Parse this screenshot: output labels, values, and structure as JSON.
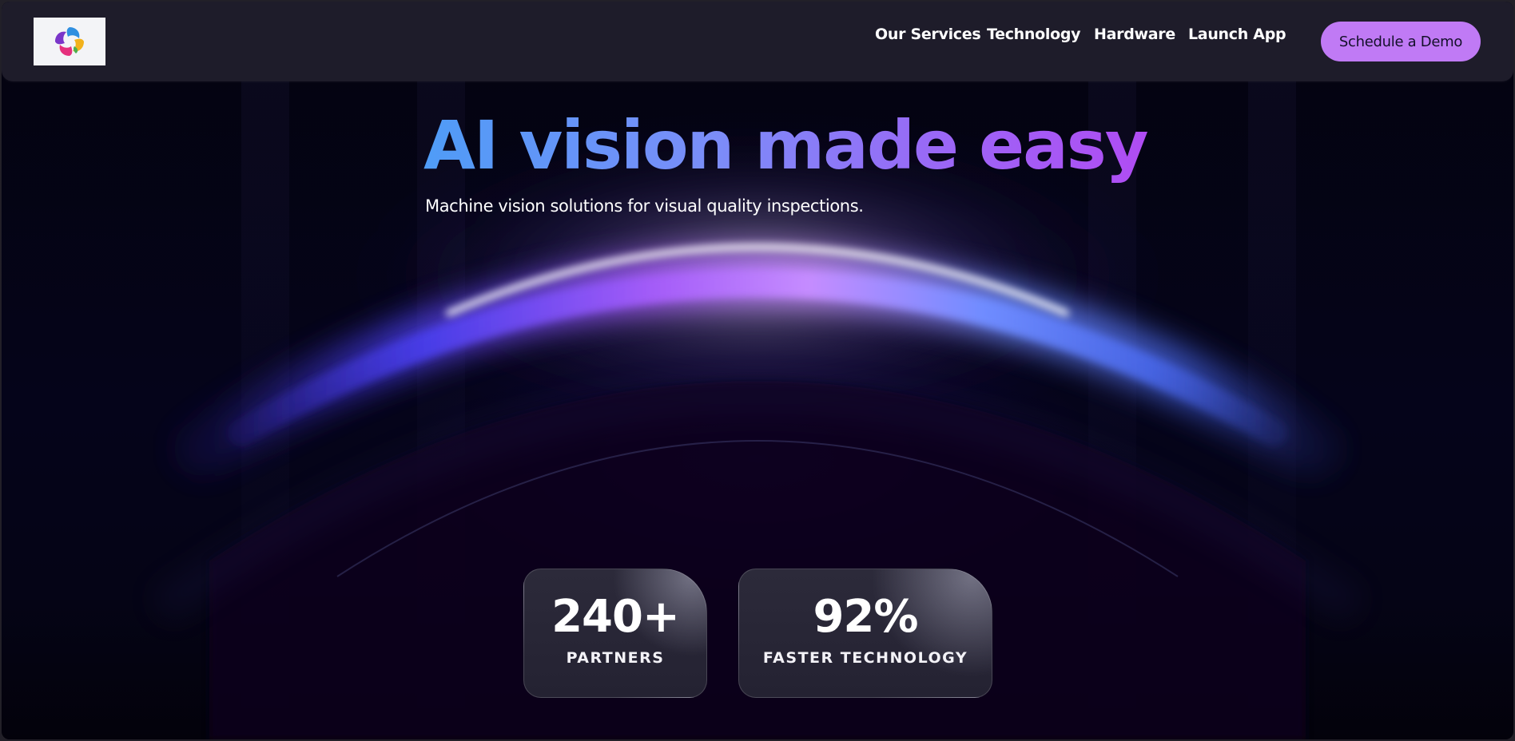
{
  "nav": {
    "logo": "logo-swirl",
    "links": [
      {
        "label": "Our Services",
        "has_dropdown": true
      },
      {
        "label": "Technology"
      },
      {
        "label": "Hardware"
      },
      {
        "label": "Launch App"
      }
    ],
    "cta_label": "Schedule a Demo"
  },
  "hero": {
    "title": "AI vision made easy",
    "subtitle": "Machine vision solutions for visual quality inspections."
  },
  "stats": [
    {
      "value": "240+",
      "label": "PARTNERS"
    },
    {
      "value": "92%",
      "label": "FASTER TECHNOLOGY"
    }
  ],
  "colors": {
    "accent": "#c07af5",
    "title_gradient_start": "#4f9cf7",
    "title_gradient_end": "#b04cf3",
    "background": "#03020d",
    "nav_background": "#1e1c2a"
  }
}
